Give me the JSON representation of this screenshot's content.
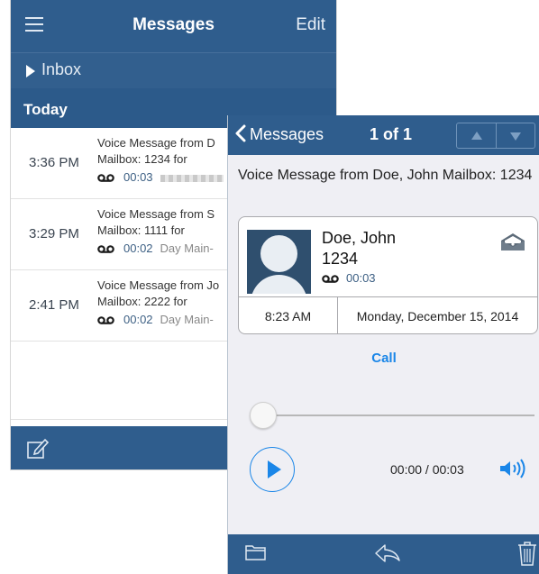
{
  "inbox_list": {
    "title": "Messages",
    "edit_label": "Edit",
    "folder_label": "Inbox",
    "section_label": "Today",
    "messages": [
      {
        "time": "3:36 PM",
        "line1": "Voice Message from D",
        "line2": "Mailbox: 1234 for",
        "duration": "00:03",
        "extra": ""
      },
      {
        "time": "3:29 PM",
        "line1": "Voice Message from S",
        "line2": "Mailbox: 1111 for",
        "duration": "00:02",
        "extra": "Day Main-"
      },
      {
        "time": "2:41 PM",
        "line1": "Voice Message from Jo",
        "line2": "Mailbox: 2222 for",
        "duration": "00:02",
        "extra": "Day Main-"
      }
    ]
  },
  "detail": {
    "back_label": "Messages",
    "counter": "1 of 1",
    "subject": "Voice Message from Doe, John Mailbox: 1234",
    "caller_name": "Doe, John",
    "caller_ext": "1234",
    "duration": "00:03",
    "time": "8:23 AM",
    "date": "Monday, December 15, 2014",
    "call_label": "Call",
    "playback_position": "00:00 / 00:03",
    "playback_progress": 0
  },
  "colors": {
    "nav_bar": "#2f5d8d",
    "accent": "#1a86e8",
    "background": "#efeff4"
  },
  "icons": [
    "menu-icon",
    "triangle-right-icon",
    "voicemail-icon",
    "compose-icon",
    "chevron-left-icon",
    "arrow-up-icon",
    "arrow-down-icon",
    "envelope-open-icon",
    "play-icon",
    "speaker-icon",
    "folder-icon",
    "reply-icon",
    "trash-icon"
  ]
}
